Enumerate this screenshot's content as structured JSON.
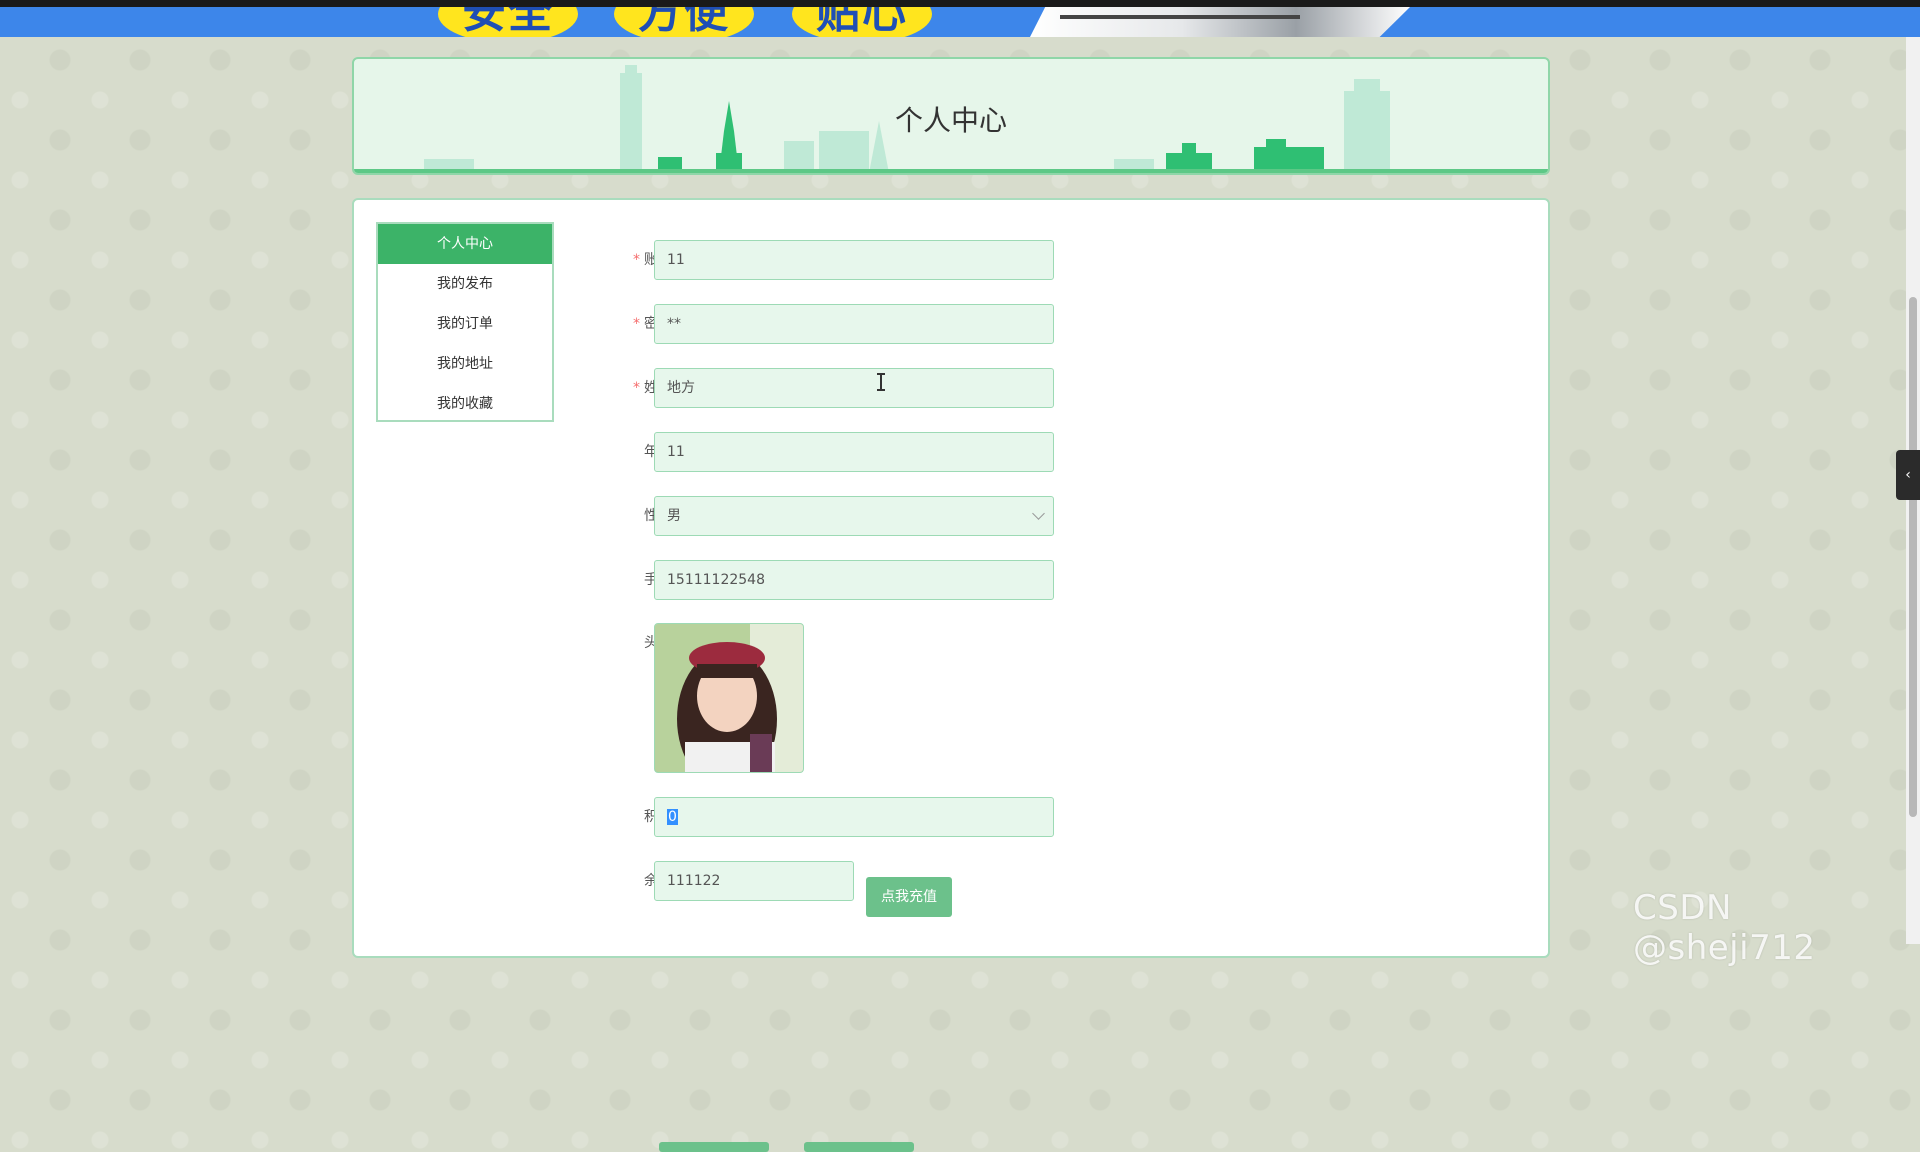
{
  "banner": {
    "badges": [
      "安全",
      "方便",
      "贴心"
    ],
    "colors": {
      "banner_bg": "#3d86ea",
      "badge_bg": "#ffe51e",
      "badge_text": "#1f4fb5"
    }
  },
  "header": {
    "title": "个人中心"
  },
  "sidebar": {
    "items": [
      {
        "label": "个人中心",
        "active": true
      },
      {
        "label": "我的发布",
        "active": false
      },
      {
        "label": "我的订单",
        "active": false
      },
      {
        "label": "我的地址",
        "active": false
      },
      {
        "label": "我的收藏",
        "active": false
      }
    ],
    "active_color": "#3cb368"
  },
  "form": {
    "account": {
      "label": "账号",
      "value": "11",
      "required": true
    },
    "password": {
      "label": "密码",
      "value": "**",
      "required": true
    },
    "name": {
      "label": "姓名",
      "value": "地方",
      "required": true
    },
    "age": {
      "label": "年龄",
      "value": "11"
    },
    "gender": {
      "label": "性别",
      "value": "男"
    },
    "phone": {
      "label": "手机",
      "value": "15111122548"
    },
    "avatar": {
      "label": "头像"
    },
    "points": {
      "label": "积分",
      "value": "0"
    },
    "balance": {
      "label": "余额",
      "value": "111122"
    },
    "recharge_button": "点我充值"
  },
  "watermark": "CSDN @sheji712",
  "side_toggle": "‹"
}
